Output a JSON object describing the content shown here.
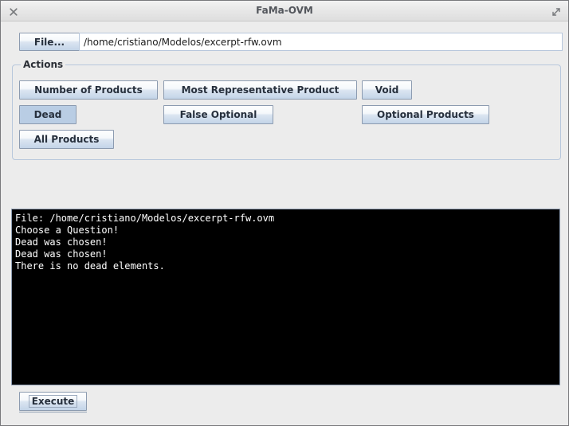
{
  "window": {
    "title": "FaMa-OVM",
    "close_icon": "close-icon",
    "maximize_icon": "maximize-icon",
    "background_color": "#ececec",
    "border_color": "#78797c"
  },
  "file_row": {
    "button_label": "File...",
    "path_value": "/home/cristiano/Modelos/excerpt-rfw.ovm",
    "path_placeholder": ""
  },
  "actions": {
    "group_title": "Actions",
    "buttons": [
      {
        "id": "number-of-products",
        "label": "Number of Products",
        "selected": false
      },
      {
        "id": "most-representative-product",
        "label": "Most Representative Product",
        "selected": false
      },
      {
        "id": "void",
        "label": "Void",
        "selected": false
      },
      {
        "id": "dead",
        "label": "Dead",
        "selected": true
      },
      {
        "id": "false-optional",
        "label": "False Optional",
        "selected": false
      },
      {
        "id": "optional-products",
        "label": "Optional Products",
        "selected": false
      },
      {
        "id": "all-products",
        "label": "All Products",
        "selected": false
      }
    ]
  },
  "console": {
    "background_color": "#000000",
    "text_color": "#ffffff",
    "lines": [
      "File: /home/cristiano/Modelos/excerpt-rfw.ovm",
      "Choose a Question!",
      "Dead was chosen!",
      "Dead was chosen!",
      "There is no dead elements."
    ]
  },
  "footer": {
    "execute_label": "Execute"
  }
}
